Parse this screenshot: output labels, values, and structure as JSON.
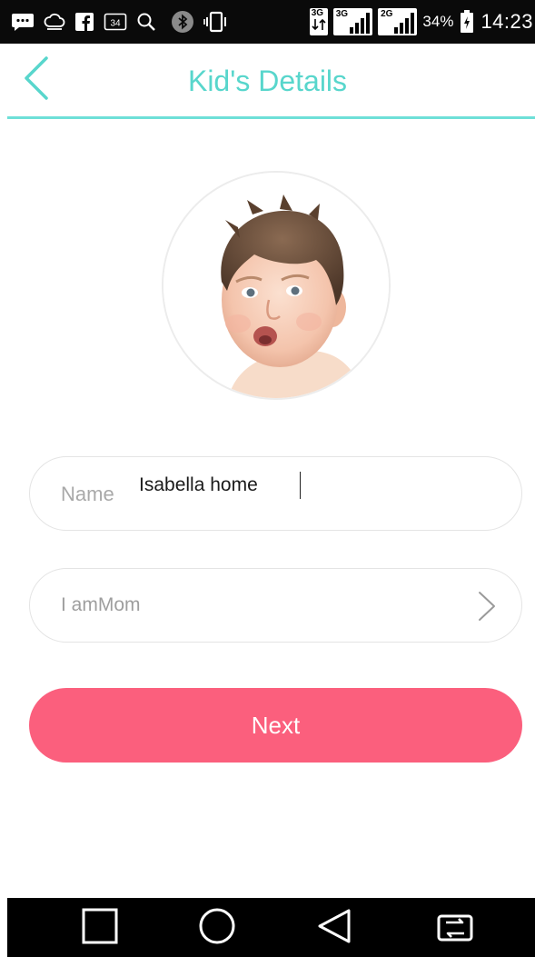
{
  "status_bar": {
    "icons": [
      "message-icon",
      "cloud-icon",
      "facebook-icon",
      "calendar-icon",
      "search-icon",
      "bluetooth-icon",
      "vibrate-icon",
      "data-transfer-icon",
      "signal-icon",
      "signal-icon"
    ],
    "calendar_day": "34",
    "network_1": "3G",
    "network_2": "3G",
    "network_3": "2G",
    "battery_percent": "34%",
    "time": "14:23"
  },
  "header": {
    "title": "Kid's Details",
    "back_icon": "chevron-left-icon"
  },
  "form": {
    "name_label": "Name",
    "name_value": "Isabella home",
    "role_text": "I amMom",
    "role_icon": "chevron-right-icon"
  },
  "actions": {
    "next_label": "Next"
  },
  "nav_bar": {
    "icons": [
      "recents-square-icon",
      "home-circle-icon",
      "back-triangle-icon",
      "screen-switch-icon"
    ]
  },
  "colors": {
    "accent": "#58d6cc",
    "primary_button": "#fb5f7d",
    "field_border": "#e4e4e4",
    "placeholder": "#a9a9a9"
  }
}
